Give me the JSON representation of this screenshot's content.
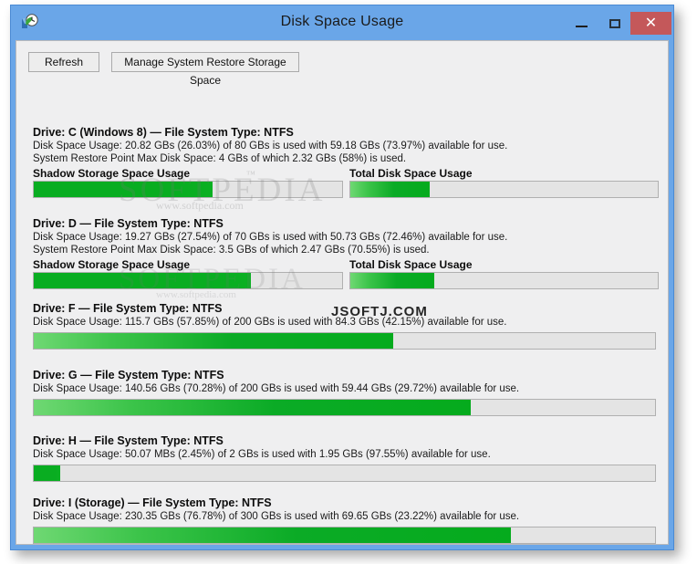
{
  "window": {
    "title": "Disk Space Usage",
    "app_icon": "clock-restore-icon",
    "minimize_label": "–",
    "maximize_label": "□",
    "close_label": "✕",
    "accent_color": "#6aa6e8",
    "close_button_color": "#c4585a",
    "bar_fill_color": "#0bab26",
    "bar_track_color": "#e4e4e4"
  },
  "toolbar": {
    "refresh_label": "Refresh",
    "manage_label": "Manage System Restore Storage Space"
  },
  "labels": {
    "shadow_storage": "Shadow Storage Space Usage",
    "total_disk": "Total Disk Space Usage"
  },
  "watermarks": {
    "softpedia": "SOFTPEDIA",
    "softpedia_tm": "™",
    "softpedia_url": "www.softpedia.com",
    "jsoftj": "JSOFTJ.COM"
  },
  "drives": [
    {
      "title": "Drive: C (Windows 8) — File System Type: NTFS",
      "usage_line": "Disk Space Usage: 20.82 GBs (26.03%) of 80 GBs is used with 59.18 GBs (73.97%) available for use.",
      "restore_line": "System Restore Point Max Disk Space: 4 GBs of which 2.32 GBs (58%) is used.",
      "has_shadow": true,
      "shadow_percent": 58,
      "total_percent": 26.03,
      "used_gb": 20.82,
      "used_percent": 26.03,
      "capacity_gb": 80,
      "free_gb": 59.18,
      "free_percent": 73.97,
      "restore_max_gb": 4,
      "restore_used_gb": 2.32,
      "restore_used_percent": 58
    },
    {
      "title": "Drive: D — File System Type: NTFS",
      "usage_line": "Disk Space Usage: 19.27 GBs (27.54%) of 70 GBs is used with 50.73 GBs (72.46%) available for use.",
      "restore_line": "System Restore Point Max Disk Space: 3.5 GBs of which 2.47 GBs (70.55%) is used.",
      "has_shadow": true,
      "shadow_percent": 70.55,
      "total_percent": 27.54,
      "used_gb": 19.27,
      "used_percent": 27.54,
      "capacity_gb": 70,
      "free_gb": 50.73,
      "free_percent": 72.46,
      "restore_max_gb": 3.5,
      "restore_used_gb": 2.47,
      "restore_used_percent": 70.55
    },
    {
      "title": "Drive: F — File System Type: NTFS",
      "usage_line": "Disk Space Usage: 115.7 GBs (57.85%) of 200 GBs is used with 84.3 GBs (42.15%) available for use.",
      "restore_line": "",
      "has_shadow": false,
      "total_percent": 57.85,
      "used_gb": 115.7,
      "used_percent": 57.85,
      "capacity_gb": 200,
      "free_gb": 84.3,
      "free_percent": 42.15
    },
    {
      "title": "Drive: G — File System Type: NTFS",
      "usage_line": "Disk Space Usage: 140.56 GBs (70.28%) of 200 GBs is used with 59.44 GBs (29.72%) available for use.",
      "restore_line": "",
      "has_shadow": false,
      "total_percent": 70.28,
      "used_gb": 140.56,
      "used_percent": 70.28,
      "capacity_gb": 200,
      "free_gb": 59.44,
      "free_percent": 29.72
    },
    {
      "title": "Drive: H — File System Type: NTFS",
      "usage_line": "Disk Space Usage: 50.07 MBs (2.45%) of 2 GBs is used with 1.95 GBs (97.55%) available for use.",
      "restore_line": "",
      "has_shadow": false,
      "total_percent": 2.45,
      "used_mb": 50.07,
      "used_percent": 2.45,
      "capacity_gb": 2,
      "free_gb": 1.95,
      "free_percent": 97.55
    },
    {
      "title": "Drive: I (Storage) — File System Type: NTFS",
      "usage_line": "Disk Space Usage: 230.35 GBs (76.78%) of 300 GBs is used with 69.65 GBs (23.22%) available for use.",
      "restore_line": "",
      "has_shadow": false,
      "total_percent": 76.78,
      "used_gb": 230.35,
      "used_percent": 76.78,
      "capacity_gb": 300,
      "free_gb": 69.65,
      "free_percent": 23.22
    }
  ]
}
